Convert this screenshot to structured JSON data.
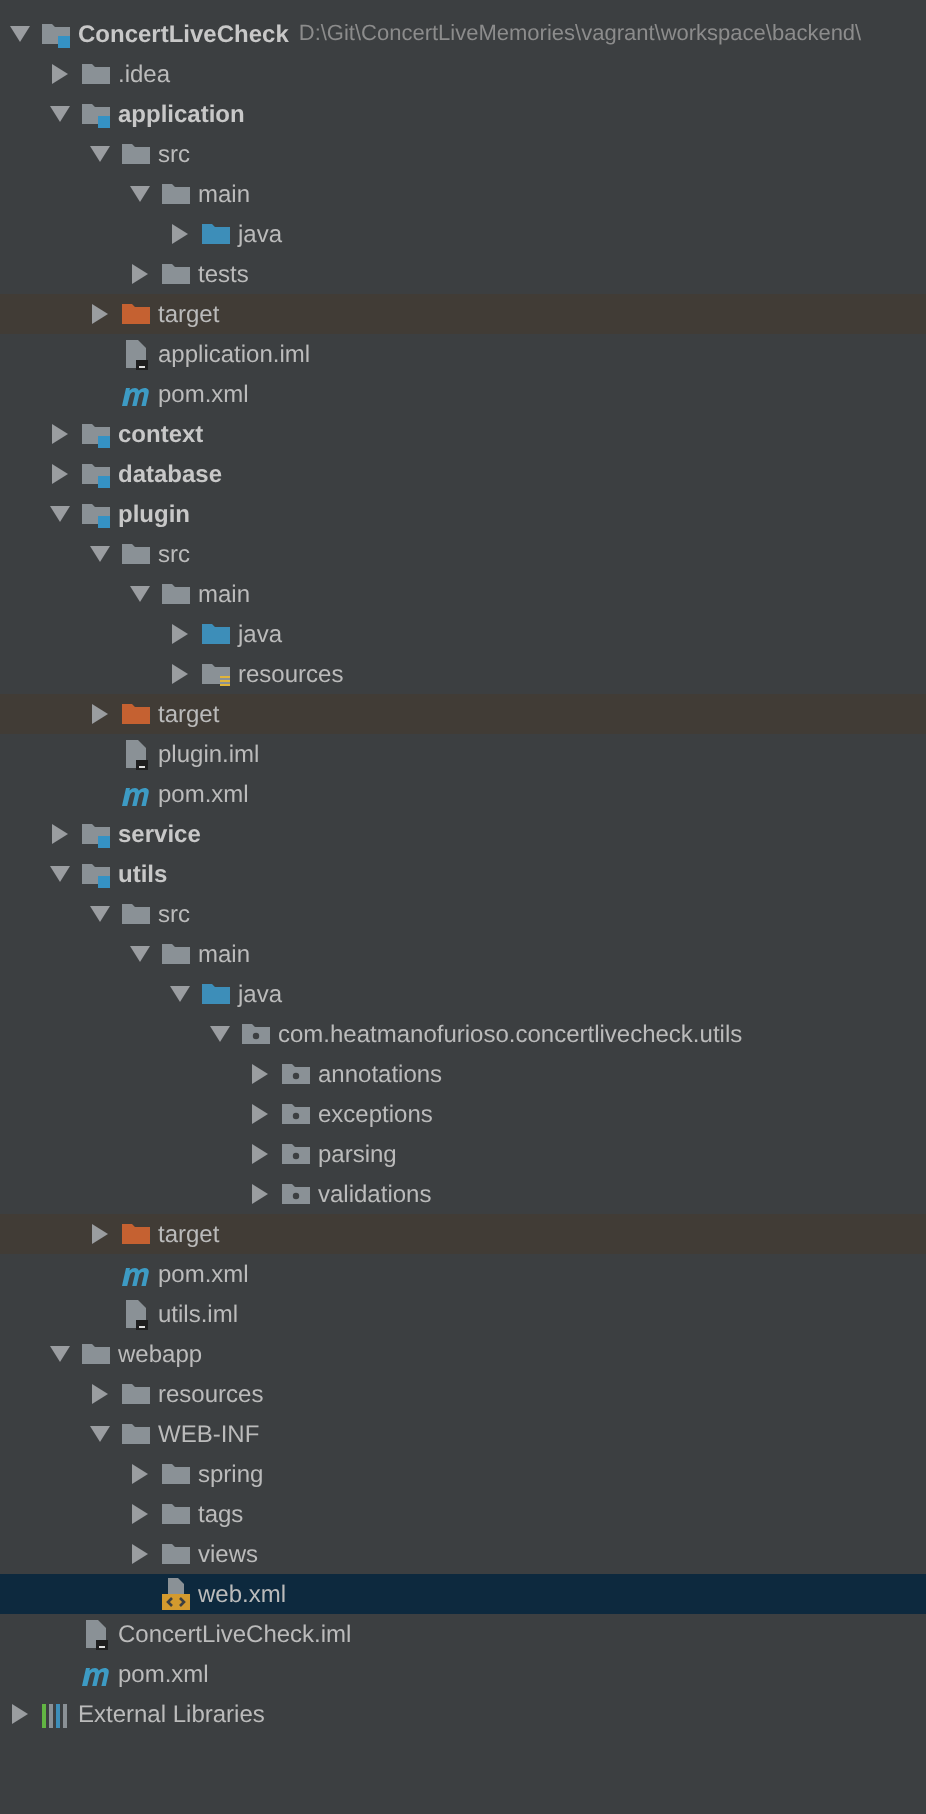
{
  "tree": [
    {
      "kind": "module",
      "label": "ConcertLiveCheck",
      "path": "D:\\Git\\ConcertLiveMemories\\vagrant\\workspace\\backend\\",
      "expanded": true,
      "selected": false,
      "children": [
        {
          "kind": "folder",
          "label": ".idea",
          "expanded": false,
          "selected": false
        },
        {
          "kind": "module",
          "label": "application",
          "expanded": true,
          "selected": false,
          "children": [
            {
              "kind": "folder",
              "label": "src",
              "expanded": true,
              "selected": false,
              "children": [
                {
                  "kind": "folder",
                  "label": "main",
                  "expanded": true,
                  "selected": false,
                  "children": [
                    {
                      "kind": "source",
                      "label": "java",
                      "expanded": false,
                      "selected": false
                    }
                  ]
                },
                {
                  "kind": "folder",
                  "label": "tests",
                  "expanded": false,
                  "selected": false
                }
              ]
            },
            {
              "kind": "excluded",
              "label": "target",
              "expanded": false,
              "selected": false
            },
            {
              "kind": "iml",
              "label": "application.iml",
              "selected": false
            },
            {
              "kind": "maven",
              "label": "pom.xml",
              "selected": false
            }
          ]
        },
        {
          "kind": "module",
          "label": "context",
          "expanded": false,
          "selected": false
        },
        {
          "kind": "module",
          "label": "database",
          "expanded": false,
          "selected": false
        },
        {
          "kind": "module",
          "label": "plugin",
          "expanded": true,
          "selected": false,
          "children": [
            {
              "kind": "folder",
              "label": "src",
              "expanded": true,
              "selected": false,
              "children": [
                {
                  "kind": "folder",
                  "label": "main",
                  "expanded": true,
                  "selected": false,
                  "children": [
                    {
                      "kind": "source",
                      "label": "java",
                      "expanded": false,
                      "selected": false
                    },
                    {
                      "kind": "resources",
                      "label": "resources",
                      "expanded": false,
                      "selected": false
                    }
                  ]
                }
              ]
            },
            {
              "kind": "excluded",
              "label": "target",
              "expanded": false,
              "selected": false
            },
            {
              "kind": "iml",
              "label": "plugin.iml",
              "selected": false
            },
            {
              "kind": "maven",
              "label": "pom.xml",
              "selected": false
            }
          ]
        },
        {
          "kind": "module",
          "label": "service",
          "expanded": false,
          "selected": false
        },
        {
          "kind": "module",
          "label": "utils",
          "expanded": true,
          "selected": false,
          "children": [
            {
              "kind": "folder",
              "label": "src",
              "expanded": true,
              "selected": false,
              "children": [
                {
                  "kind": "folder",
                  "label": "main",
                  "expanded": true,
                  "selected": false,
                  "children": [
                    {
                      "kind": "source",
                      "label": "java",
                      "expanded": true,
                      "selected": false,
                      "children": [
                        {
                          "kind": "package",
                          "label": "com.heatmanofurioso.concertlivecheck.utils",
                          "expanded": true,
                          "selected": false,
                          "children": [
                            {
                              "kind": "package",
                              "label": "annotations",
                              "expanded": false,
                              "selected": false
                            },
                            {
                              "kind": "package",
                              "label": "exceptions",
                              "expanded": false,
                              "selected": false
                            },
                            {
                              "kind": "package",
                              "label": "parsing",
                              "expanded": false,
                              "selected": false
                            },
                            {
                              "kind": "package",
                              "label": "validations",
                              "expanded": false,
                              "selected": false
                            }
                          ]
                        }
                      ]
                    }
                  ]
                }
              ]
            },
            {
              "kind": "excluded",
              "label": "target",
              "expanded": false,
              "selected": false
            },
            {
              "kind": "maven",
              "label": "pom.xml",
              "selected": false
            },
            {
              "kind": "iml",
              "label": "utils.iml",
              "selected": false
            }
          ]
        },
        {
          "kind": "folder",
          "label": "webapp",
          "expanded": true,
          "selected": false,
          "children": [
            {
              "kind": "folder",
              "label": "resources",
              "expanded": false,
              "selected": false
            },
            {
              "kind": "folder",
              "label": "WEB-INF",
              "expanded": true,
              "selected": false,
              "children": [
                {
                  "kind": "folder",
                  "label": "spring",
                  "expanded": false,
                  "selected": false
                },
                {
                  "kind": "folder",
                  "label": "tags",
                  "expanded": false,
                  "selected": false
                },
                {
                  "kind": "folder",
                  "label": "views",
                  "expanded": false,
                  "selected": false
                },
                {
                  "kind": "xml",
                  "label": "web.xml",
                  "selected": true
                }
              ]
            }
          ]
        },
        {
          "kind": "iml",
          "label": "ConcertLiveCheck.iml",
          "selected": false
        },
        {
          "kind": "maven",
          "label": "pom.xml",
          "selected": false
        }
      ]
    },
    {
      "kind": "libraries",
      "label": "External Libraries",
      "expanded": false,
      "selected": false
    }
  ]
}
